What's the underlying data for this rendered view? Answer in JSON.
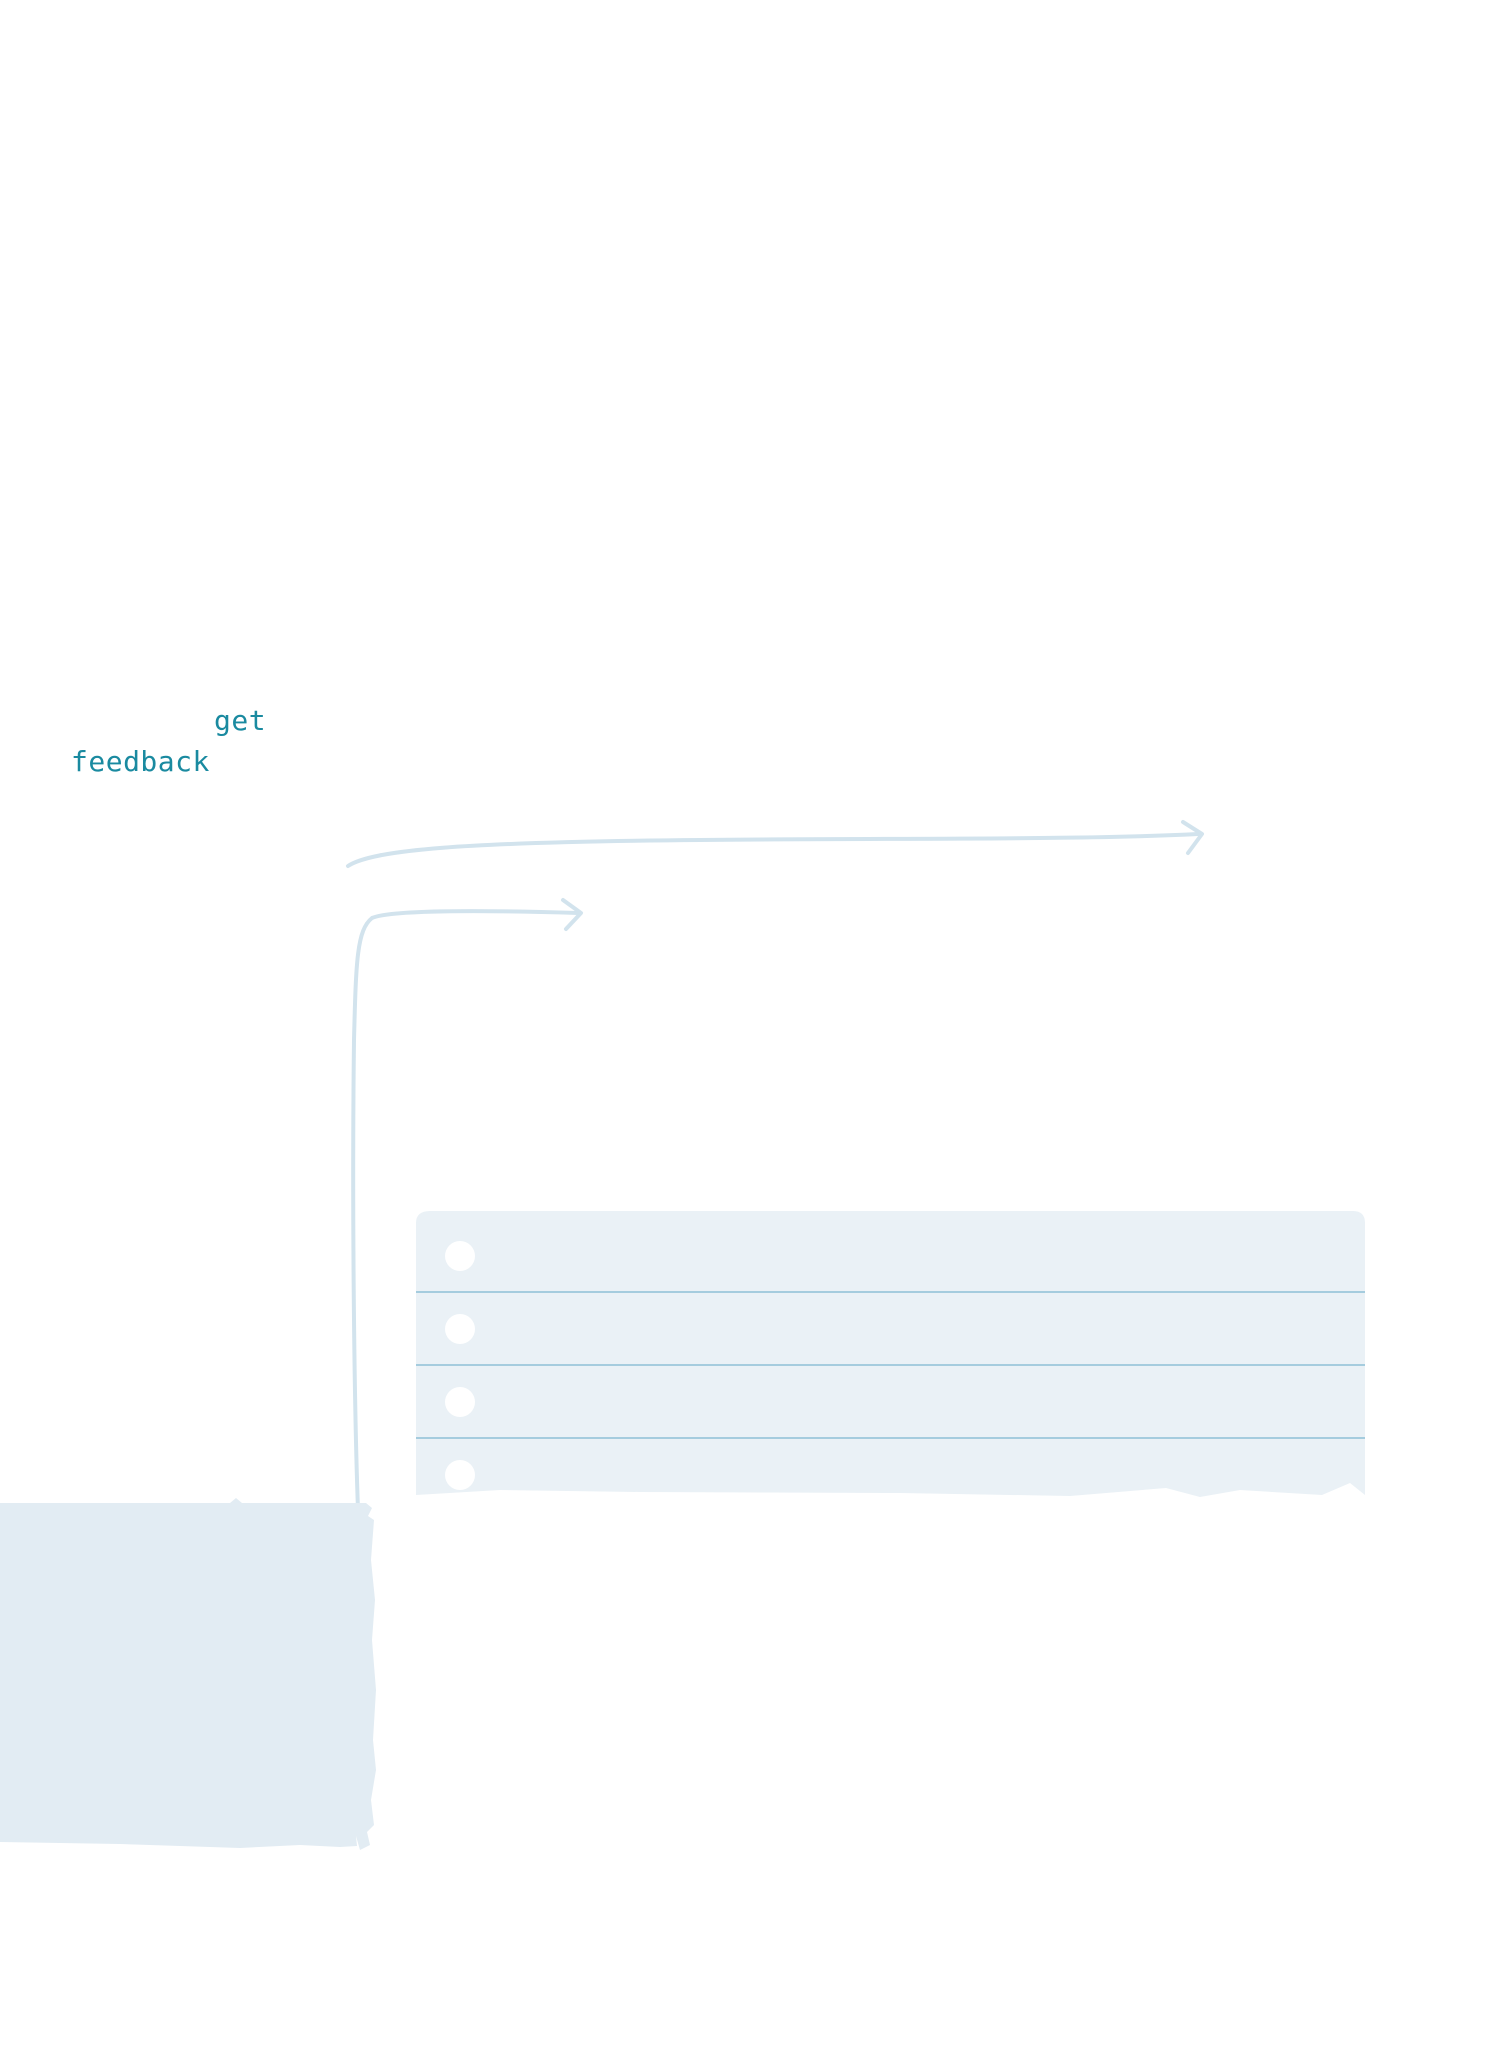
{
  "annotations": {
    "get": "get",
    "feedback": "feedback"
  },
  "list_card": {
    "row_count": 4
  },
  "colors": {
    "annotation_text": "#1a8aa0",
    "arrow_stroke": "#d2e3ed",
    "card_fill": "#eaf1f6",
    "row_divider": "#8ebfd6",
    "bullet_fill": "#ffffff",
    "torn_panel_fill": "#e2ecf3",
    "page_background": "#ffffff"
  }
}
